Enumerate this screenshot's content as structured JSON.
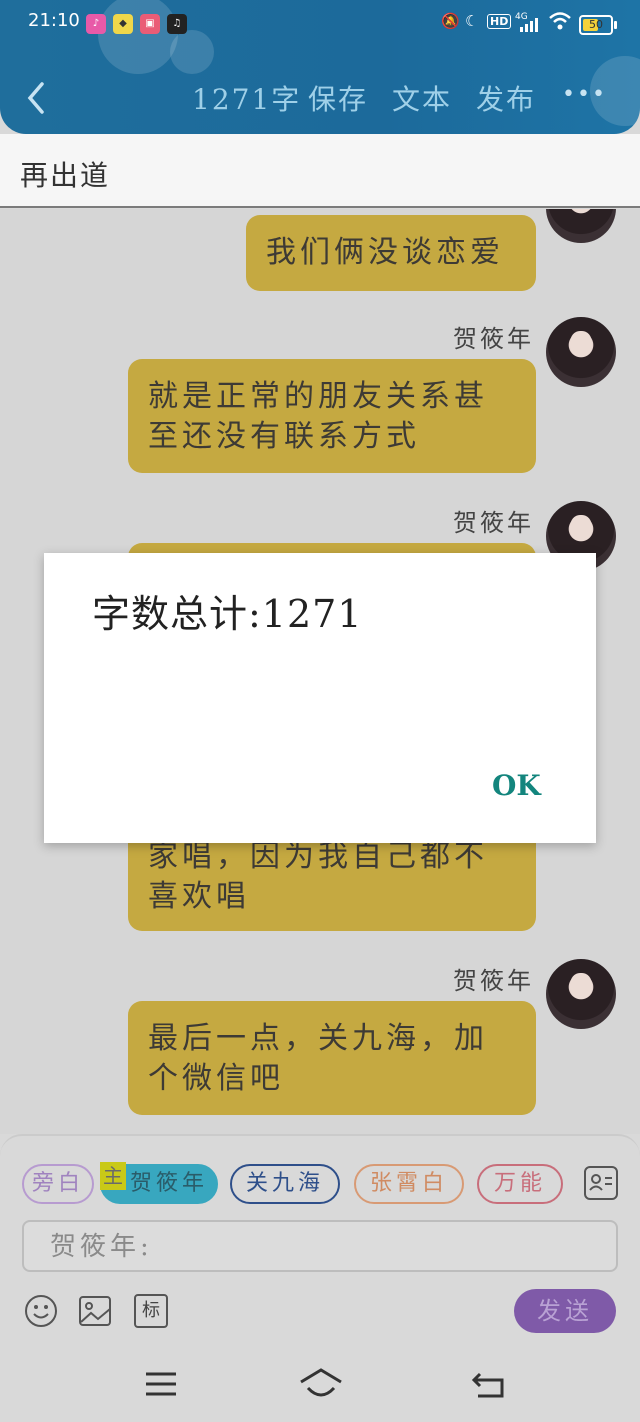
{
  "status_bar": {
    "time": "21:10",
    "battery_level": "50",
    "network": "4G",
    "hd_label": "HD"
  },
  "header": {
    "word_count": "1271字",
    "save": "保存",
    "text": "文本",
    "publish": "发布",
    "more": "•••"
  },
  "title": "再出道",
  "chat": {
    "messages": [
      {
        "text": "我们俩没谈恋爱"
      },
      {
        "speaker": "贺筱年",
        "text": "就是正常的朋友关系甚至还没有联系方式"
      },
      {
        "speaker": "贺筱年",
        "text": ""
      },
      {
        "text": "家唱，因为我自己都不喜欢唱"
      },
      {
        "speaker": "贺筱年",
        "text": "最后一点，关九海，加个微信吧"
      }
    ]
  },
  "dialog": {
    "message": "字数总计:1271",
    "ok": "OK"
  },
  "roles": {
    "narration": "旁白",
    "main_tag": "主",
    "he_xiaonian": "贺筱年",
    "guan_jiuhai": "关九海",
    "zhang_xiaobai": "张霄白",
    "universal": "万能"
  },
  "input": {
    "placeholder": "贺筱年:"
  },
  "toolbar": {
    "tag_label": "标",
    "send": "发送"
  },
  "colors": {
    "header": "#1f6e9c",
    "bubble": "#c5a941",
    "ok_text": "#13857d",
    "send_button": "#7f5aa8",
    "active_role": "#38a7bf"
  }
}
